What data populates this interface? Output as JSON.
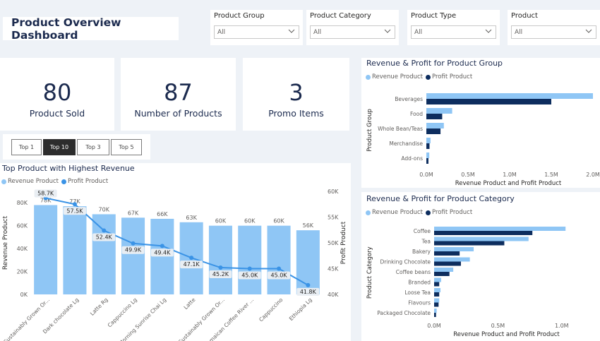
{
  "header": {
    "title": "Product Overview Dashboard"
  },
  "filters": [
    {
      "label": "Product Group",
      "value": "All"
    },
    {
      "label": "Product Category",
      "value": "All"
    },
    {
      "label": "Product Type",
      "value": "All"
    },
    {
      "label": "Product",
      "value": "All"
    }
  ],
  "kpis": [
    {
      "value": "80",
      "caption": "Product Sold"
    },
    {
      "value": "87",
      "caption": "Number of Products"
    },
    {
      "value": "3",
      "caption": "Promo Items"
    }
  ],
  "top_slicer": {
    "options": [
      "Top 1",
      "Top 10",
      "Top 3",
      "Top 5"
    ],
    "selected": "Top 10"
  },
  "colors": {
    "revenue": "#8fc6f5",
    "profit_group": "#0d2d5e",
    "profit_line": "#3a93e6",
    "title": "#1b2a4e"
  },
  "chart_data": [
    {
      "type": "bar",
      "title": "Top Product with Highest Revenue",
      "legend": [
        "Revenue Product",
        "Profit Product"
      ],
      "xlabel": "",
      "ylabel": "Revenue Product",
      "y2label": "Profit Product",
      "categories": [
        "Sustainably Grown Or...",
        "Dark chocolate Lg",
        "Latte Rg",
        "Cappuccino Lg",
        "Morning Sunrise Chai Lg",
        "Latte",
        "Sustainably Grown Or...",
        "Jamaican Coffee River ...",
        "Cappuccino",
        "Ethiopia Lg"
      ],
      "series": [
        {
          "name": "Revenue Product",
          "values": [
            78000,
            77000,
            70000,
            67000,
            66000,
            63000,
            60000,
            60000,
            60000,
            56000
          ],
          "bar_labels": [
            "78K",
            "77K",
            "70K",
            "67K",
            "66K",
            "63K",
            "60K",
            "60K",
            "60K",
            "56K"
          ]
        },
        {
          "name": "Profit Product",
          "values": [
            58700,
            57500,
            52400,
            49900,
            49400,
            47100,
            45200,
            45000,
            45000,
            41800
          ],
          "point_labels": [
            "58.7K",
            "57.5K",
            "52.4K",
            "49.9K",
            "49.4K",
            "47.1K",
            "45.2K",
            "45.0K",
            "45.0K",
            "41.8K"
          ]
        }
      ],
      "ylim": [
        0,
        90000
      ],
      "y_ticks": [
        "0K",
        "20K",
        "40K",
        "60K",
        "80K"
      ],
      "y2lim": [
        40000,
        60000
      ],
      "y2_ticks": [
        "40K",
        "45K",
        "50K",
        "55K",
        "60K"
      ]
    },
    {
      "type": "bar",
      "orientation": "horizontal",
      "title": "Revenue & Profit for Product Group",
      "legend": [
        "Revenue Product",
        "Profit Product"
      ],
      "xlabel": "Revenue Product and Profit Product",
      "ylabel": "Product Group",
      "categories": [
        "Beverages",
        "Food",
        "Whole Bean/Teas",
        "Merchandise",
        "Add-ons"
      ],
      "series": [
        {
          "name": "Revenue Product",
          "values": [
            2000000,
            310000,
            210000,
            50000,
            35000
          ]
        },
        {
          "name": "Profit Product",
          "values": [
            1500000,
            190000,
            170000,
            38000,
            25000
          ]
        }
      ],
      "xlim": [
        0,
        2000000
      ],
      "x_ticks": [
        "0.0M",
        "0.5M",
        "1.0M",
        "1.5M",
        "2.0M"
      ]
    },
    {
      "type": "bar",
      "orientation": "horizontal",
      "title": "Revenue & Profit for Product Category",
      "legend": [
        "Revenue Product",
        "Profit Product"
      ],
      "xlabel": "Revenue Product and Profit Product",
      "ylabel": "Product Category",
      "categories": [
        "Coffee",
        "Tea",
        "Bakery",
        "Drinking Chocolate",
        "Coffee beans",
        "Branded",
        "Loose Tea",
        "Flavours",
        "Packaged Chocolate"
      ],
      "series": [
        {
          "name": "Revenue Product",
          "values": [
            1030000,
            740000,
            310000,
            280000,
            150000,
            55000,
            50000,
            40000,
            20000
          ]
        },
        {
          "name": "Profit Product",
          "values": [
            770000,
            550000,
            200000,
            210000,
            120000,
            40000,
            40000,
            35000,
            15000
          ]
        }
      ],
      "xlim": [
        0,
        1300000
      ],
      "x_ticks": [
        "0.0M",
        "0.5M",
        "1.0M"
      ]
    }
  ]
}
